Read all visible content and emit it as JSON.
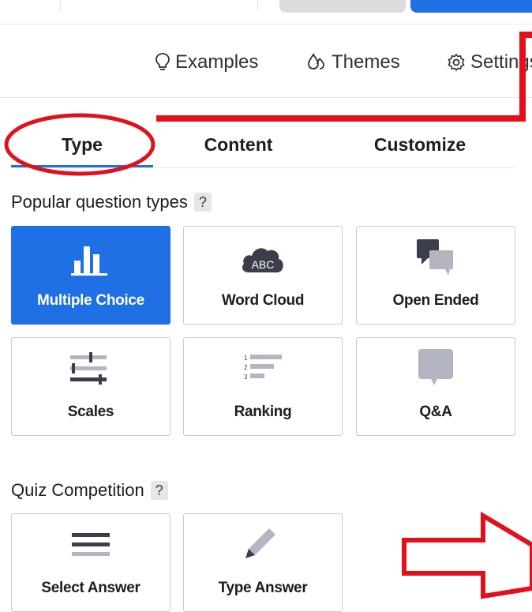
{
  "toolbar": {
    "examples_label": "Examples",
    "themes_label": "Themes",
    "settings_label": "Settings"
  },
  "tabs": [
    {
      "label": "Type",
      "active": true
    },
    {
      "label": "Content",
      "active": false
    },
    {
      "label": "Customize",
      "active": false
    }
  ],
  "sections": {
    "popular": {
      "title": "Popular question types",
      "help": "?",
      "cards": [
        {
          "label": "Multiple Choice",
          "icon": "bar-chart-icon",
          "selected": true
        },
        {
          "label": "Word Cloud",
          "icon": "word-cloud-icon",
          "icon_text": "ABC",
          "selected": false
        },
        {
          "label": "Open Ended",
          "icon": "speech-bubbles-icon",
          "selected": false
        },
        {
          "label": "Scales",
          "icon": "scales-icon",
          "selected": false
        },
        {
          "label": "Ranking",
          "icon": "ranking-icon",
          "icon_text": [
            "1",
            "2",
            "3"
          ],
          "selected": false
        },
        {
          "label": "Q&A",
          "icon": "qa-bubble-icon",
          "selected": false
        }
      ]
    },
    "quiz": {
      "title": "Quiz Competition",
      "help": "?",
      "cards": [
        {
          "label": "Select Answer",
          "icon": "list-lines-icon",
          "selected": false
        },
        {
          "label": "Type Answer",
          "icon": "pencil-icon",
          "selected": false
        }
      ]
    }
  },
  "colors": {
    "accent": "#1f6fe5",
    "annotation": "#e3101c",
    "icon_dark": "#4a4c5a",
    "icon_light": "#b3b6c0"
  }
}
